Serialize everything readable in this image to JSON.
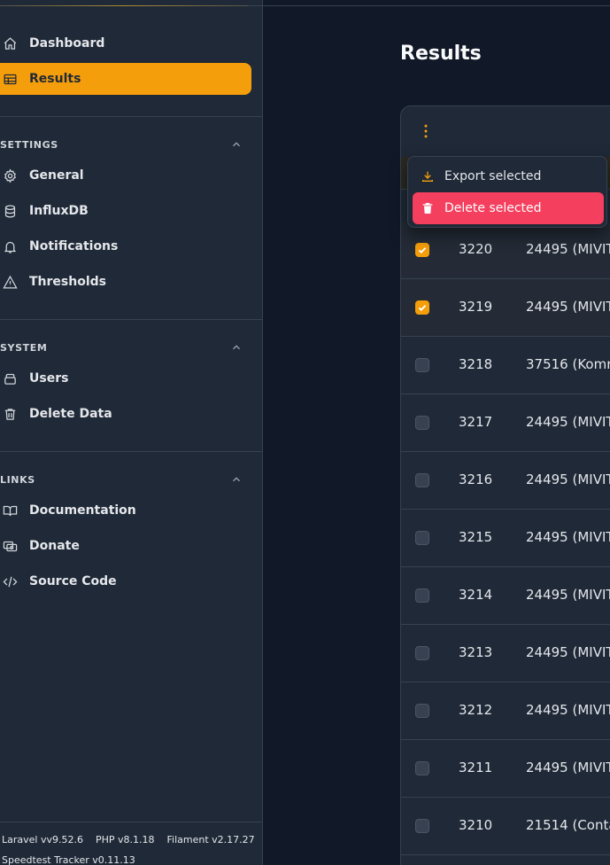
{
  "sidebar": {
    "nav": [
      {
        "label": "Dashboard",
        "icon": "home-icon",
        "active": false
      },
      {
        "label": "Results",
        "icon": "table-icon",
        "active": true
      }
    ],
    "sections": [
      {
        "title": "SETTINGS",
        "items": [
          {
            "label": "General",
            "icon": "cog-icon"
          },
          {
            "label": "InfluxDB",
            "icon": "database-icon"
          },
          {
            "label": "Notifications",
            "icon": "bell-icon"
          },
          {
            "label": "Thresholds",
            "icon": "warning-icon"
          }
        ]
      },
      {
        "title": "SYSTEM",
        "items": [
          {
            "label": "Users",
            "icon": "users-icon"
          },
          {
            "label": "Delete Data",
            "icon": "trash-icon"
          }
        ]
      },
      {
        "title": "LINKS",
        "items": [
          {
            "label": "Documentation",
            "icon": "book-icon"
          },
          {
            "label": "Donate",
            "icon": "donate-icon"
          },
          {
            "label": "Source Code",
            "icon": "code-icon"
          }
        ]
      }
    ],
    "footer": {
      "laravel": "Laravel vv9.52.6",
      "php": "PHP v8.1.18",
      "filament": "Filament v2.17.27",
      "tracker": "Speedtest Tracker v0.11.13"
    }
  },
  "main": {
    "title": "Results",
    "dropdown": {
      "export_label": "Export selected",
      "delete_label": "Delete selected"
    },
    "rows": [
      {
        "id": "3220",
        "server": "24495 (MIVIT",
        "checked": true
      },
      {
        "id": "3219",
        "server": "24495 (MIVIT",
        "checked": true
      },
      {
        "id": "3218",
        "server": "37516 (Komro",
        "checked": false
      },
      {
        "id": "3217",
        "server": "24495 (MIVIT",
        "checked": false
      },
      {
        "id": "3216",
        "server": "24495 (MIVIT",
        "checked": false
      },
      {
        "id": "3215",
        "server": "24495 (MIVIT",
        "checked": false
      },
      {
        "id": "3214",
        "server": "24495 (MIVIT",
        "checked": false
      },
      {
        "id": "3213",
        "server": "24495 (MIVIT",
        "checked": false
      },
      {
        "id": "3212",
        "server": "24495 (MIVIT",
        "checked": false
      },
      {
        "id": "3211",
        "server": "24495 (MIVIT",
        "checked": false
      },
      {
        "id": "3210",
        "server": "21514 (Contal",
        "checked": false
      }
    ]
  },
  "colors": {
    "accent": "#f59e0b",
    "danger": "#f43f5e",
    "sidebar_bg": "#1f2937",
    "page_bg": "#111827"
  }
}
